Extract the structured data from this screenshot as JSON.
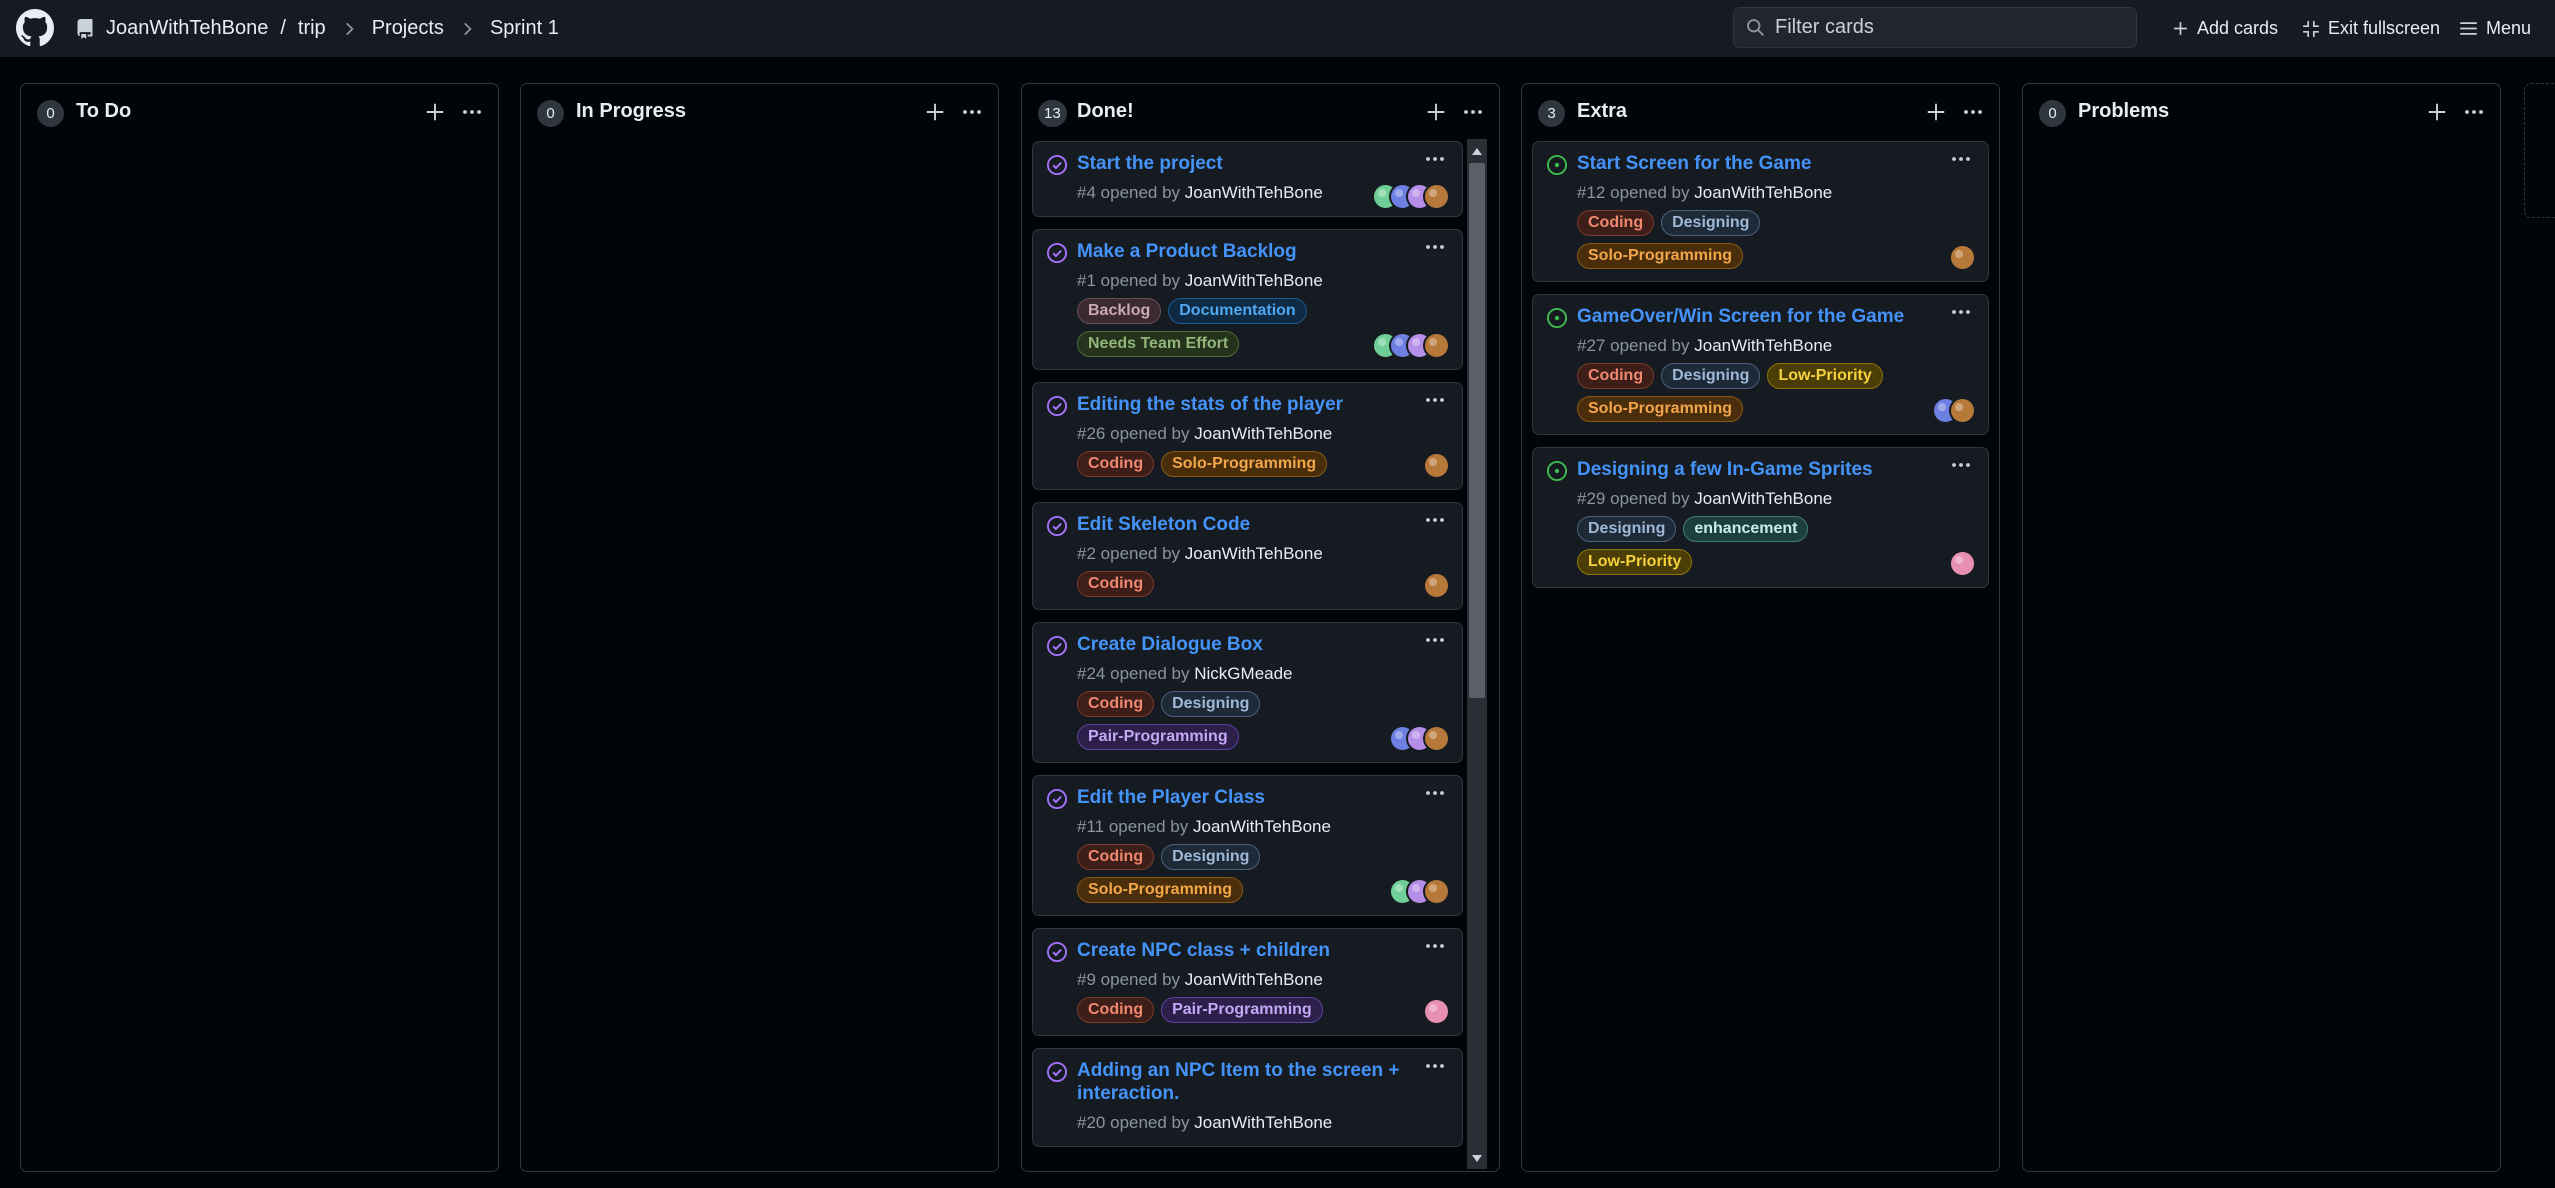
{
  "header": {
    "owner": "JoanWithTehBone",
    "repo": "trip",
    "crumb_projects": "Projects",
    "crumb_board": "Sprint 1",
    "filter_placeholder": "Filter cards",
    "add_cards": "Add cards",
    "exit_fullscreen": "Exit fullscreen",
    "menu": "Menu"
  },
  "columns": [
    {
      "title": "To Do",
      "count": "0",
      "cards": []
    },
    {
      "title": "In Progress",
      "count": "0",
      "cards": []
    },
    {
      "title": "Done!",
      "count": "13",
      "cards": [
        {
          "title": "Start the project",
          "number": "#4",
          "opened_by": "opened by",
          "author": "JoanWithTehBone",
          "labels": [],
          "avatars": [
            "green",
            "blue",
            "purple",
            "brown"
          ],
          "state": "closed"
        },
        {
          "title": "Make a Product Backlog",
          "number": "#1",
          "opened_by": "opened by",
          "author": "JoanWithTehBone",
          "labels": [
            "Backlog",
            "Documentation",
            "Needs Team Effort"
          ],
          "avatars": [
            "green",
            "blue",
            "purple",
            "brown"
          ],
          "state": "closed"
        },
        {
          "title": "Editing the stats of the player",
          "number": "#26",
          "opened_by": "opened by",
          "author": "JoanWithTehBone",
          "labels": [
            "Coding",
            "Solo-Programming"
          ],
          "avatars": [
            "brown"
          ],
          "state": "closed"
        },
        {
          "title": "Edit Skeleton Code",
          "number": "#2",
          "opened_by": "opened by",
          "author": "JoanWithTehBone",
          "labels": [
            "Coding"
          ],
          "avatars": [
            "brown"
          ],
          "state": "closed"
        },
        {
          "title": "Create Dialogue Box",
          "number": "#24",
          "opened_by": "opened by",
          "author": "NickGMeade",
          "labels": [
            "Coding",
            "Designing",
            "Pair-Programming"
          ],
          "avatars": [
            "blue",
            "purple",
            "brown"
          ],
          "state": "closed"
        },
        {
          "title": "Edit the Player Class",
          "number": "#11",
          "opened_by": "opened by",
          "author": "JoanWithTehBone",
          "labels": [
            "Coding",
            "Designing",
            "Solo-Programming"
          ],
          "avatars": [
            "green",
            "purple",
            "brown"
          ],
          "state": "closed"
        },
        {
          "title": "Create NPC class + children",
          "number": "#9",
          "opened_by": "opened by",
          "author": "JoanWithTehBone",
          "labels": [
            "Coding",
            "Pair-Programming"
          ],
          "avatars": [
            "pink"
          ],
          "state": "closed"
        },
        {
          "title": "Adding an NPC Item to the screen + interaction.",
          "number": "#20",
          "opened_by": "opened by",
          "author": "JoanWithTehBone",
          "labels": [],
          "avatars": [],
          "state": "closed"
        }
      ]
    },
    {
      "title": "Extra",
      "count": "3",
      "cards": [
        {
          "title": "Start Screen for the Game",
          "number": "#12",
          "opened_by": "opened by",
          "author": "JoanWithTehBone",
          "labels": [
            "Coding",
            "Designing",
            "Solo-Programming"
          ],
          "avatars": [
            "brown"
          ],
          "state": "open"
        },
        {
          "title": "GameOver/Win Screen for the Game",
          "number": "#27",
          "opened_by": "opened by",
          "author": "JoanWithTehBone",
          "labels": [
            "Coding",
            "Designing",
            "Low-Priority",
            "Solo-Programming"
          ],
          "avatars": [
            "blue",
            "brown"
          ],
          "state": "open"
        },
        {
          "title": "Designing a few In-Game Sprites",
          "number": "#29",
          "opened_by": "opened by",
          "author": "JoanWithTehBone",
          "labels": [
            "Designing",
            "enhancement",
            "Low-Priority"
          ],
          "avatars": [
            "pink"
          ],
          "state": "open"
        }
      ]
    },
    {
      "title": "Problems",
      "count": "0",
      "cards": []
    }
  ],
  "label_colors": {
    "Backlog": {
      "fg": "#c9a9b6",
      "bg": "#3b2a30",
      "border": "#6b4d58"
    },
    "Documentation": {
      "fg": "#4fa8f0",
      "bg": "#0f2a44",
      "border": "#1d5a8f"
    },
    "Needs Team Effort": {
      "fg": "#93b57a",
      "bg": "#25331c",
      "border": "#4d6b38"
    },
    "Coding": {
      "fg": "#f0876f",
      "bg": "#3d1e18",
      "border": "#7a3a2c"
    },
    "Solo-Programming": {
      "fg": "#f2a64a",
      "bg": "#4a2e0c",
      "border": "#8a5612"
    },
    "Designing": {
      "fg": "#9fb8d6",
      "bg": "#1f2a38",
      "border": "#4a617c"
    },
    "Pair-Programming": {
      "fg": "#c4a8f5",
      "bg": "#2c1f4a",
      "border": "#5c43a0"
    },
    "Low-Priority": {
      "fg": "#f5d13d",
      "bg": "#4a3d06",
      "border": "#8f7508"
    },
    "enhancement": {
      "fg": "#c5f0ea",
      "bg": "#1d3f3b",
      "border": "#3e7d74"
    }
  },
  "avatar_colors": {
    "green": "#6fcf97",
    "blue": "#6d7fe0",
    "purple": "#b68ee8",
    "brown": "#b7793a",
    "pink": "#e88fb4"
  },
  "state_colors": {
    "closed": "#a371f7",
    "open": "#3fb950"
  }
}
